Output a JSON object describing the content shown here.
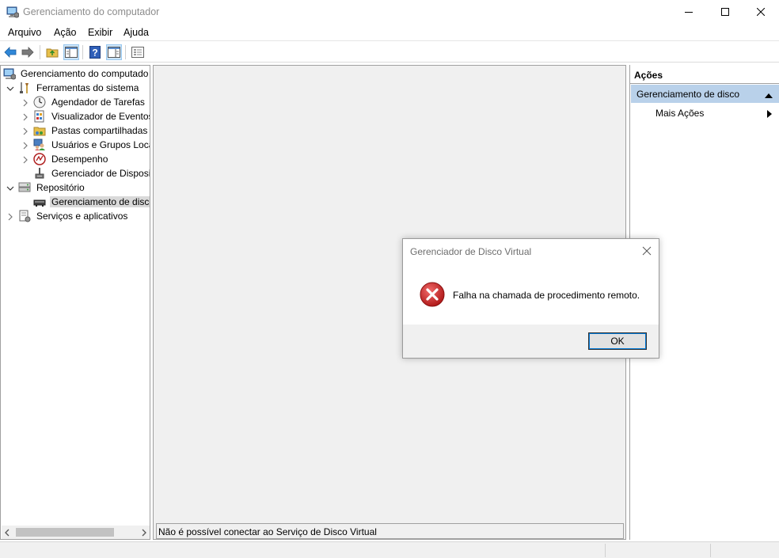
{
  "window": {
    "title": "Gerenciamento do computador"
  },
  "menu": {
    "items": [
      "Arquivo",
      "Ação",
      "Exibir",
      "Ajuda"
    ]
  },
  "tree": {
    "items": [
      {
        "label": "Gerenciamento do computado",
        "icon": "computer-management-icon"
      },
      {
        "label": "Ferramentas do sistema",
        "icon": "system-tools-icon"
      },
      {
        "label": "Agendador de Tarefas",
        "icon": "task-scheduler-icon"
      },
      {
        "label": "Visualizador de Eventos",
        "icon": "event-viewer-icon"
      },
      {
        "label": "Pastas compartilhadas",
        "icon": "shared-folders-icon"
      },
      {
        "label": "Usuários e Grupos Loca",
        "icon": "users-groups-icon"
      },
      {
        "label": "Desempenho",
        "icon": "performance-icon"
      },
      {
        "label": "Gerenciador de Disposit",
        "icon": "device-manager-icon"
      },
      {
        "label": "Repositório",
        "icon": "storage-icon"
      },
      {
        "label": "Gerenciamento de disco",
        "icon": "disk-management-icon"
      },
      {
        "label": "Serviços e aplicativos",
        "icon": "services-apps-icon"
      }
    ]
  },
  "center": {
    "status_message": "Não é possível conectar ao Serviço de Disco Virtual"
  },
  "actions": {
    "header": "Ações",
    "section": "Gerenciamento de disco",
    "more": "Mais Ações"
  },
  "dialog": {
    "title": "Gerenciador de Disco Virtual",
    "message": "Falha na chamada de procedimento remoto.",
    "ok_label": "OK",
    "icon": "error-icon"
  },
  "colors": {
    "selection_bg": "#b9d1ea",
    "error_red": "#d32f2f",
    "focus_blue": "#0078d7"
  }
}
